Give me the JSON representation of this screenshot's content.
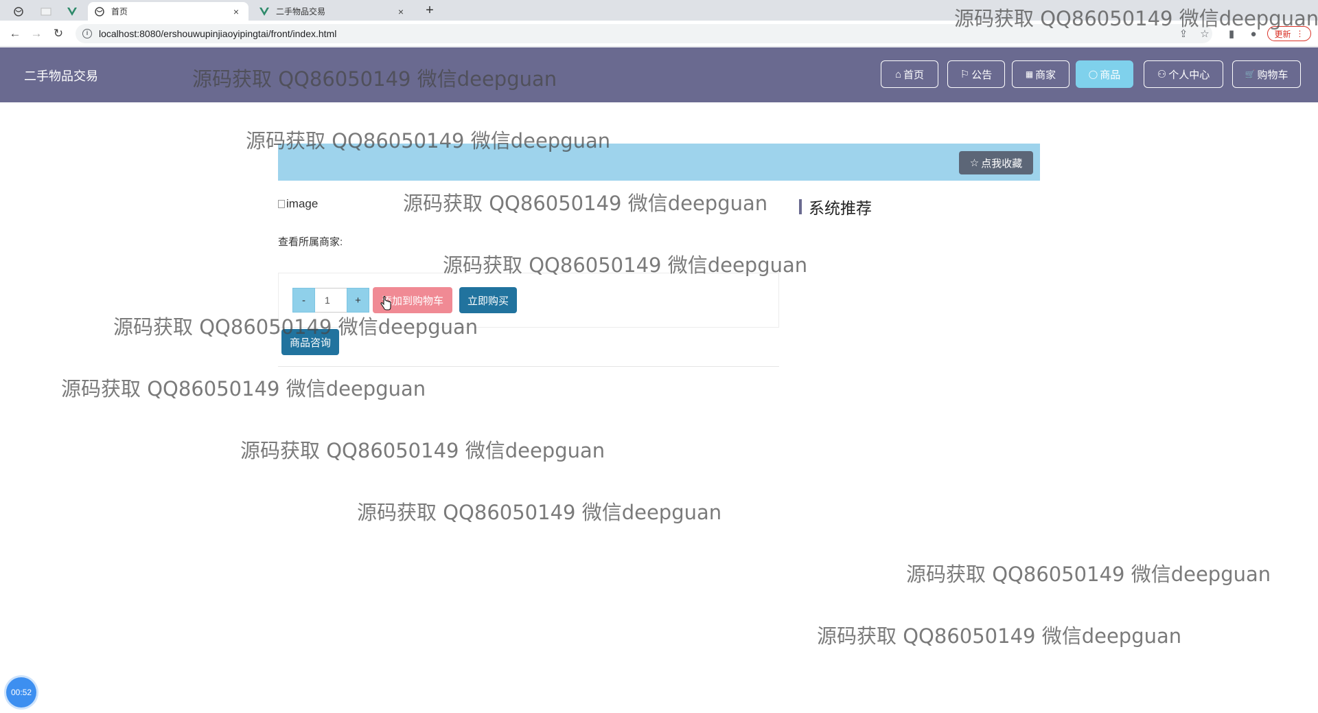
{
  "browser": {
    "tabs": [
      {
        "title": "首页",
        "icon": "globe-icon",
        "active": true
      },
      {
        "title": "二手物品交易",
        "icon": "vue-icon",
        "active": false
      }
    ],
    "close_glyph": "×",
    "new_tab_glyph": "+",
    "url": "localhost:8080/ershouwupinjiaoyipingtai/front/index.html",
    "update_label": "更新"
  },
  "header": {
    "brand": "二手物品交易",
    "nav": [
      {
        "icon": "⌂",
        "label": "首页"
      },
      {
        "icon": "⚐",
        "label": "公告"
      },
      {
        "icon": "▦",
        "label": "商家"
      },
      {
        "icon": "◯",
        "label": "商品"
      },
      {
        "icon": "⚇",
        "label": "个人中心"
      },
      {
        "icon": "🛒",
        "label": "购物车"
      }
    ]
  },
  "product": {
    "favorite_icon": "☆",
    "favorite_label": "点我收藏",
    "image_alt": "image",
    "recommend_title": "系统推荐",
    "merchant_label": "查看所属商家:",
    "quantity": "1",
    "minus": "-",
    "plus": "+",
    "add_to_cart": "添加到购物车",
    "buy_now": "立即购买",
    "consult": "商品咨询"
  },
  "timer": "00:52",
  "watermark": "源码获取 QQ86050149 微信deepguan"
}
